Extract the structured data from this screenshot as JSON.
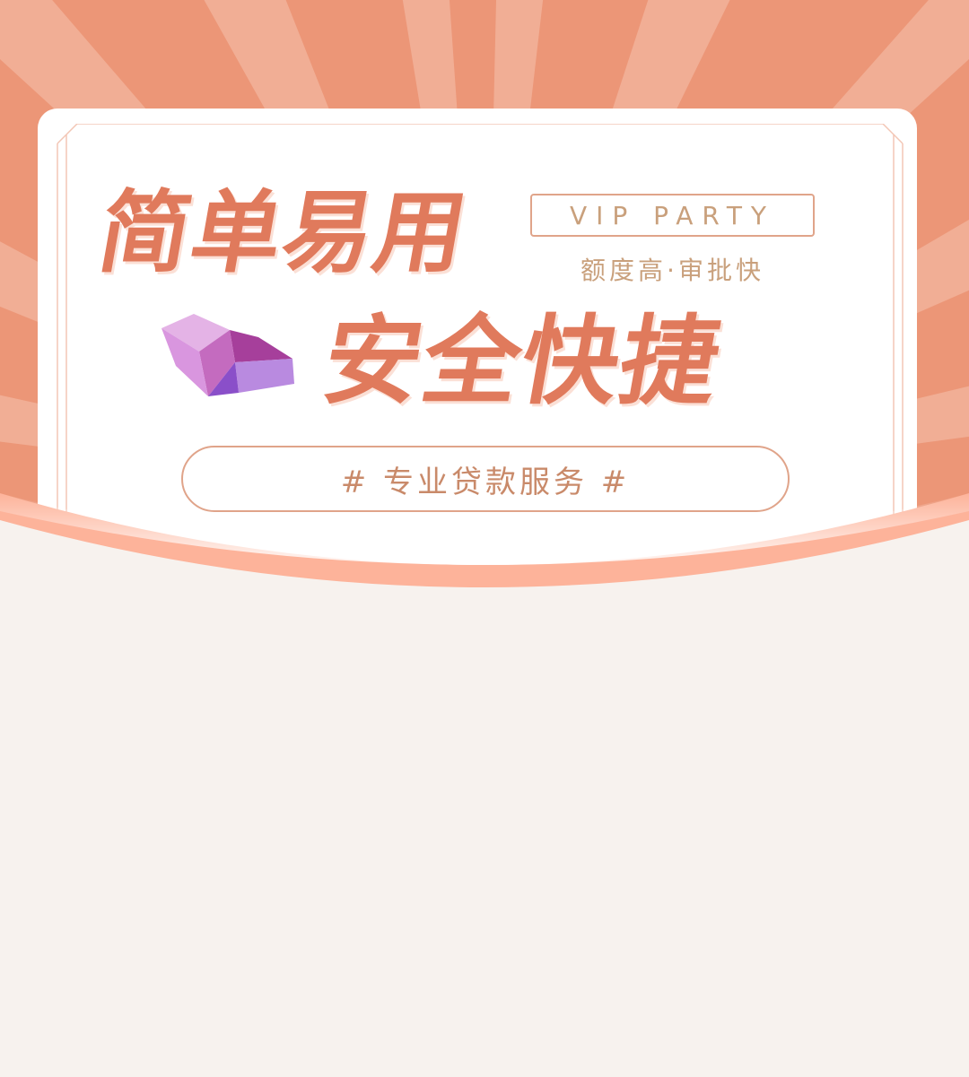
{
  "banner": {
    "headline_1": "简单易用",
    "headline_2": "安全快捷",
    "vip_tag": "VIP PARTY",
    "sub_tag": "额度高·审批快",
    "service_pill": "# 专业贷款服务 #"
  },
  "colors": {
    "accent": "#e07a5c",
    "ray_dark": "#ec9677",
    "ray_light": "#f2b39b",
    "gold_text": "#c9a07c",
    "page_bg": "#f7f2ee",
    "gem_purple": "#a356c9"
  },
  "icons": {
    "gem": "purple-gem-icon"
  }
}
